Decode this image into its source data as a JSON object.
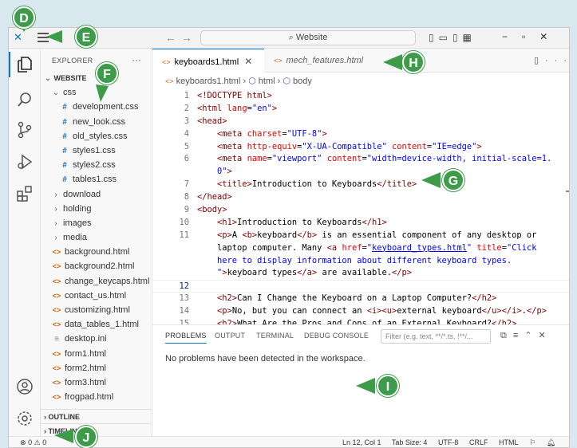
{
  "titlebar": {
    "search_label": "Website"
  },
  "explorer": {
    "title": "EXPLORER",
    "root": "WEBSITE",
    "tree": [
      {
        "kind": "folder-open",
        "label": "css",
        "indent": 1
      },
      {
        "kind": "css",
        "label": "development.css",
        "indent": 2
      },
      {
        "kind": "css",
        "label": "new_look.css",
        "indent": 2
      },
      {
        "kind": "css",
        "label": "old_styles.css",
        "indent": 2
      },
      {
        "kind": "css",
        "label": "styles1.css",
        "indent": 2
      },
      {
        "kind": "css",
        "label": "styles2.css",
        "indent": 2
      },
      {
        "kind": "css",
        "label": "tables1.css",
        "indent": 2
      },
      {
        "kind": "folder",
        "label": "download",
        "indent": 1
      },
      {
        "kind": "folder",
        "label": "holding",
        "indent": 1
      },
      {
        "kind": "folder",
        "label": "images",
        "indent": 1
      },
      {
        "kind": "folder",
        "label": "media",
        "indent": 1
      },
      {
        "kind": "html",
        "label": "background.html",
        "indent": 1
      },
      {
        "kind": "html",
        "label": "background2.html",
        "indent": 1
      },
      {
        "kind": "html",
        "label": "change_keycaps.html",
        "indent": 1
      },
      {
        "kind": "html",
        "label": "contact_us.html",
        "indent": 1
      },
      {
        "kind": "html",
        "label": "customizing.html",
        "indent": 1
      },
      {
        "kind": "html",
        "label": "data_tables_1.html",
        "indent": 1
      },
      {
        "kind": "ini",
        "label": "desktop.ini",
        "indent": 1
      },
      {
        "kind": "html",
        "label": "form1.html",
        "indent": 1
      },
      {
        "kind": "html",
        "label": "form2.html",
        "indent": 1
      },
      {
        "kind": "html",
        "label": "form3.html",
        "indent": 1
      },
      {
        "kind": "html",
        "label": "frogpad.html",
        "indent": 1
      }
    ],
    "sections": [
      "OUTLINE",
      "TIMELINE"
    ]
  },
  "tabs": [
    {
      "label": "keyboards1.html",
      "active": true
    },
    {
      "label": "mech_features.html",
      "active": false
    }
  ],
  "breadcrumb": [
    "keyboards1.html",
    "html",
    "body"
  ],
  "code_lines": [
    {
      "n": "1",
      "html": "<span class=\"t-tag\">&lt;!DOCTYPE html&gt;</span>"
    },
    {
      "n": "2",
      "html": "<span class=\"t-tag\">&lt;html </span><span class=\"t-attr\">lang</span><span class=\"t-text\">=</span><span class=\"t-val\">\"en\"</span><span class=\"t-tag\">&gt;</span>"
    },
    {
      "n": "3",
      "html": "<span class=\"t-tag\">&lt;head&gt;</span>"
    },
    {
      "n": "4",
      "html": "    <span class=\"t-tag\">&lt;meta </span><span class=\"t-attr\">charset</span><span class=\"t-text\">=</span><span class=\"t-val\">\"UTF-8\"</span><span class=\"t-tag\">&gt;</span>"
    },
    {
      "n": "5",
      "html": "    <span class=\"t-tag\">&lt;meta </span><span class=\"t-attr\">http-equiv</span><span class=\"t-text\">=</span><span class=\"t-val\">\"X-UA-Compatible\"</span><span class=\"t-tag\"> </span><span class=\"t-attr\">content</span><span class=\"t-text\">=</span><span class=\"t-val\">\"IE=edge\"</span><span class=\"t-tag\">&gt;</span>"
    },
    {
      "n": "6",
      "html": "    <span class=\"t-tag\">&lt;meta </span><span class=\"t-attr\">name</span><span class=\"t-text\">=</span><span class=\"t-val\">\"viewport\"</span><span class=\"t-tag\"> </span><span class=\"t-attr\">content</span><span class=\"t-text\">=</span><span class=\"t-val\">\"width=device-width, initial-scale=1.</span>"
    },
    {
      "n": "",
      "html": "    <span class=\"t-val\">0\"</span><span class=\"t-tag\">&gt;</span>"
    },
    {
      "n": "7",
      "html": "    <span class=\"t-tag\">&lt;title&gt;</span><span class=\"t-text\">Introduction to Keyboards</span><span class=\"t-tag\">&lt;/title&gt;</span>"
    },
    {
      "n": "8",
      "html": "<span class=\"t-tag\">&lt;/head&gt;</span>"
    },
    {
      "n": "9",
      "html": "<span class=\"t-tag\">&lt;body&gt;</span>"
    },
    {
      "n": "10",
      "html": "    <span class=\"t-tag\">&lt;h1&gt;</span><span class=\"t-text\">Introduction to Keyboards</span><span class=\"t-tag\">&lt;/h1&gt;</span>"
    },
    {
      "n": "11",
      "html": "    <span class=\"t-tag\">&lt;p&gt;</span><span class=\"t-text\">A </span><span class=\"t-tag\">&lt;b&gt;</span><span class=\"t-text\">keyboard</span><span class=\"t-tag\">&lt;/b&gt;</span><span class=\"t-text\"> is an essential component of any desktop or</span>"
    },
    {
      "n": "",
      "html": "    <span class=\"t-text\">laptop computer. Many </span><span class=\"t-tag\">&lt;a </span><span class=\"t-attr\">href</span><span class=\"t-text\">=</span><span class=\"t-val\">\"</span><span class=\"t-link\">keyboard_types.html</span><span class=\"t-val\">\"</span><span class=\"t-tag\"> </span><span class=\"t-attr\">title</span><span class=\"t-text\">=</span><span class=\"t-val\">\"Click</span>"
    },
    {
      "n": "",
      "html": "    <span class=\"t-val\">here to display information about different keyboard types.</span>"
    },
    {
      "n": "",
      "html": "    <span class=\"t-val\">\"</span><span class=\"t-tag\">&gt;</span><span class=\"t-text\">keyboard types</span><span class=\"t-tag\">&lt;/a&gt;</span><span class=\"t-text\"> are available.</span><span class=\"t-tag\">&lt;/p&gt;</span>"
    },
    {
      "n": "12",
      "html": "",
      "current": true
    },
    {
      "n": "13",
      "html": "    <span class=\"t-tag\">&lt;h2&gt;</span><span class=\"t-text\">Can I Change the Keyboard on a Laptop Computer?</span><span class=\"t-tag\">&lt;/h2&gt;</span>"
    },
    {
      "n": "14",
      "html": "    <span class=\"t-tag\">&lt;p&gt;</span><span class=\"t-text\">No, but you can connect an </span><span class=\"t-tag\">&lt;i&gt;&lt;u&gt;</span><span class=\"t-text\">external keyboard</span><span class=\"t-tag\">&lt;/u&gt;&lt;/i&gt;</span><span class=\"t-text\">.</span><span class=\"t-tag\">&lt;/p&gt;</span>"
    },
    {
      "n": "15",
      "html": "    <span class=\"t-tag\">&lt;h2&gt;</span><span class=\"t-text\">What Are the Pros and Cons of an External Keyboard?</span><span class=\"t-tag\">&lt;/h2&gt;</span>"
    }
  ],
  "panel": {
    "tabs": [
      "PROBLEMS",
      "OUTPUT",
      "TERMINAL",
      "DEBUG CONSOLE"
    ],
    "filter_placeholder": "Filter (e.g. text, **/*.ts, !**/...",
    "message": "No problems have been detected in the workspace."
  },
  "status": {
    "errors": "0",
    "warnings": "0",
    "position": "Ln 12, Col 1",
    "tab_size": "Tab Size: 4",
    "encoding": "UTF-8",
    "eol": "CRLF",
    "language": "HTML"
  },
  "callouts": [
    "D",
    "E",
    "F",
    "G",
    "H",
    "I",
    "J"
  ],
  "colors": {
    "callout": "#3d9b4a",
    "accent": "#0078d4",
    "tag": "#800000",
    "attr": "#e50000",
    "value": "#0000ff"
  }
}
